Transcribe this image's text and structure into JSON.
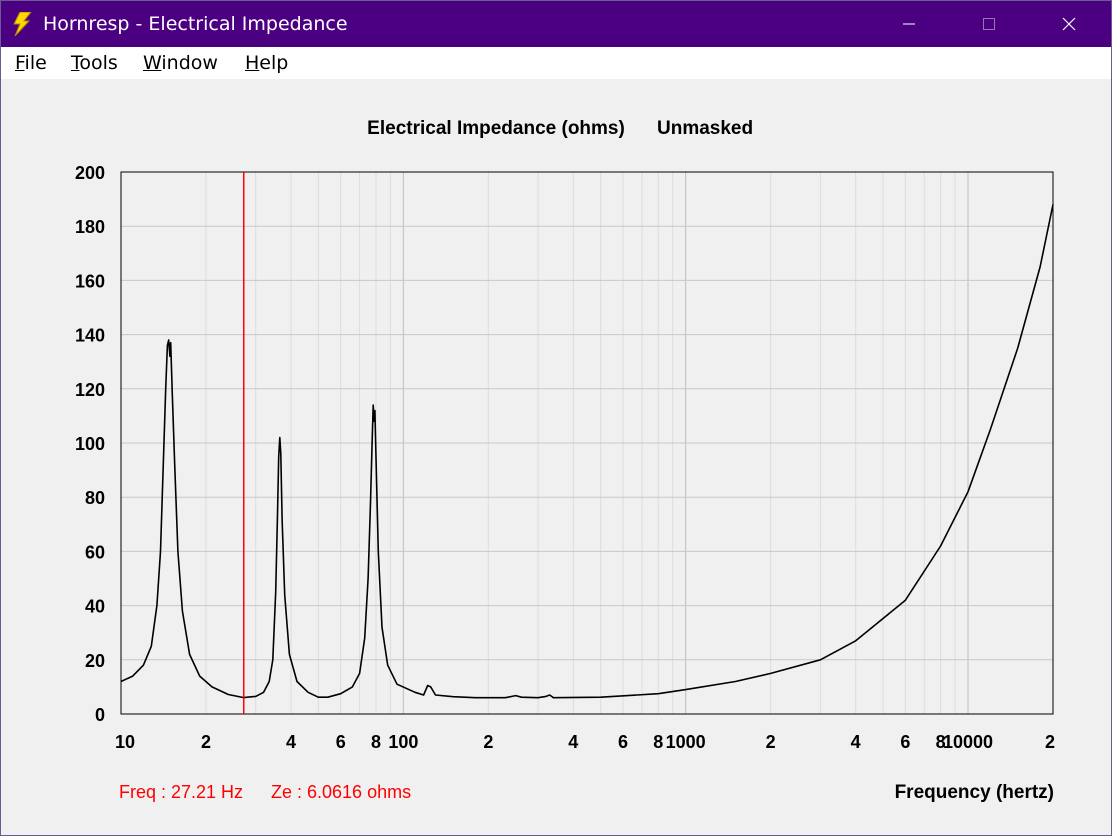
{
  "window": {
    "title": "Hornresp - Electrical Impedance",
    "controls": {
      "minimize": "minimize-icon",
      "maximize": "maximize-icon",
      "close": "close-icon"
    }
  },
  "menu": {
    "items": [
      {
        "label": "File",
        "accel": "F",
        "rest": "ile"
      },
      {
        "label": "Tools",
        "accel": "T",
        "rest": "ools"
      },
      {
        "label": "Window",
        "accel": "W",
        "rest": "indow"
      },
      {
        "label": "Help",
        "accel": "H",
        "rest": "elp"
      }
    ]
  },
  "colors": {
    "titlebar": "#4b0082",
    "cursor": "#ff0000",
    "trace": "#000000",
    "readout": "#ff0000"
  },
  "chart_data": {
    "type": "line",
    "title": "Electrical Impedance (ohms)",
    "title_tag": "Unmasked",
    "xlabel": "Frequency (hertz)",
    "ylabel": "",
    "xscale": "log",
    "xlim": [
      10,
      20000
    ],
    "ylim": [
      0,
      200
    ],
    "grid": true,
    "y_ticks": [
      0,
      20,
      40,
      60,
      80,
      100,
      120,
      140,
      160,
      180,
      200
    ],
    "x_tick_labels": [
      {
        "f": 10,
        "label": "10"
      },
      {
        "f": 20,
        "label": "2"
      },
      {
        "f": 40,
        "label": "4"
      },
      {
        "f": 60,
        "label": "6"
      },
      {
        "f": 80,
        "label": "8"
      },
      {
        "f": 100,
        "label": "100"
      },
      {
        "f": 200,
        "label": "2"
      },
      {
        "f": 400,
        "label": "4"
      },
      {
        "f": 600,
        "label": "6"
      },
      {
        "f": 800,
        "label": "8"
      },
      {
        "f": 1000,
        "label": "1000"
      },
      {
        "f": 2000,
        "label": "2"
      },
      {
        "f": 4000,
        "label": "4"
      },
      {
        "f": 6000,
        "label": "6"
      },
      {
        "f": 8000,
        "label": "8"
      },
      {
        "f": 10000,
        "label": "10000"
      },
      {
        "f": 20000,
        "label": "2"
      }
    ],
    "cursor": {
      "freq": 27.21,
      "readout_freq": "Freq : 27.21 Hz",
      "readout_ze": "Ze : 6.0616 ohms"
    },
    "series": [
      {
        "points": [
          [
            10,
            12
          ],
          [
            11,
            14
          ],
          [
            12,
            18
          ],
          [
            12.8,
            25
          ],
          [
            13.4,
            40
          ],
          [
            13.8,
            60
          ],
          [
            14.1,
            90
          ],
          [
            14.4,
            120
          ],
          [
            14.6,
            136
          ],
          [
            14.75,
            138
          ],
          [
            14.9,
            132
          ],
          [
            15.0,
            137
          ],
          [
            15.2,
            118
          ],
          [
            15.5,
            92
          ],
          [
            15.9,
            60
          ],
          [
            16.5,
            38
          ],
          [
            17.5,
            22
          ],
          [
            19,
            14
          ],
          [
            21,
            10
          ],
          [
            24,
            7.2
          ],
          [
            27.21,
            6.06
          ],
          [
            30,
            6.5
          ],
          [
            32,
            8
          ],
          [
            33.5,
            12
          ],
          [
            34.5,
            20
          ],
          [
            35.3,
            45
          ],
          [
            35.8,
            72
          ],
          [
            36.2,
            95
          ],
          [
            36.5,
            102
          ],
          [
            36.8,
            96
          ],
          [
            37.2,
            72
          ],
          [
            38,
            44
          ],
          [
            39.5,
            22
          ],
          [
            42,
            12
          ],
          [
            46,
            8
          ],
          [
            50,
            6.2
          ],
          [
            54,
            6.2
          ],
          [
            60,
            7.5
          ],
          [
            66,
            10
          ],
          [
            70,
            15
          ],
          [
            73,
            28
          ],
          [
            75,
            50
          ],
          [
            76.5,
            78
          ],
          [
            77.5,
            100
          ],
          [
            78.2,
            114
          ],
          [
            78.8,
            108
          ],
          [
            79.3,
            112
          ],
          [
            80.2,
            90
          ],
          [
            81.5,
            60
          ],
          [
            84,
            32
          ],
          [
            88,
            18
          ],
          [
            95,
            11
          ],
          [
            110,
            8
          ],
          [
            118,
            7
          ],
          [
            122,
            10.5
          ],
          [
            125,
            10
          ],
          [
            130,
            7
          ],
          [
            150,
            6.4
          ],
          [
            180,
            6
          ],
          [
            230,
            6
          ],
          [
            250,
            6.8
          ],
          [
            262,
            6.2
          ],
          [
            300,
            6
          ],
          [
            320,
            6.5
          ],
          [
            330,
            7
          ],
          [
            340,
            6
          ],
          [
            500,
            6.2
          ],
          [
            800,
            7.5
          ],
          [
            1000,
            9
          ],
          [
            1500,
            12
          ],
          [
            2000,
            15
          ],
          [
            3000,
            20
          ],
          [
            4000,
            27
          ],
          [
            6000,
            42
          ],
          [
            8000,
            62
          ],
          [
            10000,
            82
          ],
          [
            12000,
            105
          ],
          [
            15000,
            135
          ],
          [
            18000,
            165
          ],
          [
            20000,
            188
          ]
        ]
      }
    ]
  }
}
